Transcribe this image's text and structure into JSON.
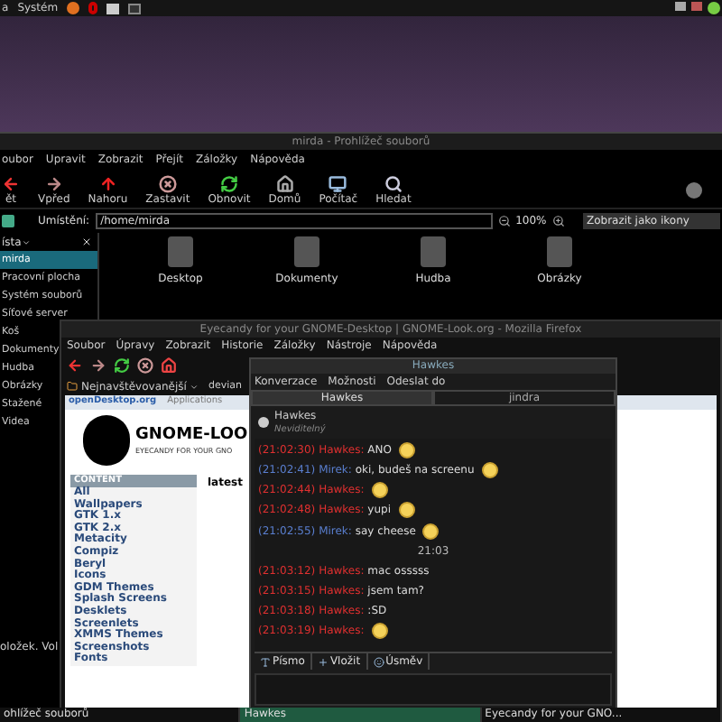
{
  "top_panel": {
    "menu": [
      "a",
      "Systém"
    ]
  },
  "file_browser": {
    "title": "mirda - Prohlížeč souborů",
    "menu": [
      "oubor",
      "Upravit",
      "Zobrazit",
      "Přejít",
      "Záložky",
      "Nápověda"
    ],
    "toolbar": [
      {
        "label": "ět",
        "kind": "back"
      },
      {
        "label": "Vpřed",
        "kind": "forward"
      },
      {
        "label": "Nahoru",
        "kind": "up"
      },
      {
        "label": "Zastavit",
        "kind": "stop"
      },
      {
        "label": "Obnovit",
        "kind": "reload"
      },
      {
        "label": "Domů",
        "kind": "home"
      },
      {
        "label": "Počítač",
        "kind": "computer"
      },
      {
        "label": "Hledat",
        "kind": "search"
      }
    ],
    "location_label": "Umístění:",
    "location": "/home/mirda",
    "zoom": "100%",
    "view_mode": "Zobrazit jako ikony",
    "sidebar_header": "ísta",
    "sidebar": [
      {
        "label": "mirda",
        "selected": true
      },
      {
        "label": "Pracovní plocha",
        "selected": false
      },
      {
        "label": "Systém souborů",
        "selected": false
      },
      {
        "label": "Síťové server",
        "selected": false
      },
      {
        "label": "Koš",
        "selected": false
      },
      {
        "label": "Dokumenty",
        "selected": false
      },
      {
        "label": "Hudba",
        "selected": false
      },
      {
        "label": "Obrázky",
        "selected": false
      },
      {
        "label": "Stažené",
        "selected": false
      },
      {
        "label": "Videa",
        "selected": false
      }
    ],
    "folders": [
      "Desktop",
      "Dokumenty",
      "Hudba",
      "Obrázky"
    ],
    "status": "oložek. Vol"
  },
  "browser": {
    "title": "Eyecandy for your GNOME-Desktop | GNOME-Look.org - Mozilla Firefox",
    "menu": [
      "Soubor",
      "Úpravy",
      "Zobrazit",
      "Historie",
      "Záložky",
      "Nástroje",
      "Nápověda"
    ],
    "bookmarks": [
      "Nejnavštěvovanější",
      "devian"
    ],
    "site_link": "openDesktop.org",
    "site_nav": [
      "Applications"
    ],
    "logo_text": "GNOME-LOO",
    "logo_tagline": "EYECANDY FOR YOUR GNO",
    "content_header": "CONTENT",
    "latest": "latest",
    "categories": [
      "All",
      "Wallpapers",
      "GTK 1.x",
      "GTK 2.x",
      "Metacity",
      "Compiz",
      "Beryl",
      "Icons",
      "GDM Themes",
      "Splash Screens",
      "Desklets",
      "Screenlets",
      "XMMS Themes",
      "Screenshots",
      "Fonts"
    ]
  },
  "chat": {
    "title": "Hawkes",
    "menu": [
      "Konverzace",
      "Možnosti",
      "Odeslat do"
    ],
    "tabs": [
      {
        "label": "Hawkes",
        "selected": true
      },
      {
        "label": "jindra",
        "selected": false
      }
    ],
    "contact": {
      "name": "Hawkes",
      "status": "Neviditelný"
    },
    "messages": [
      {
        "kind": "remote",
        "time": "(21:02:30)",
        "sender": "Hawkes:",
        "text": "ANO",
        "emoticon": true
      },
      {
        "kind": "local",
        "time": "(21:02:41)",
        "sender": "Mirek:",
        "text": "oki, budeš na screenu",
        "emoticon": true
      },
      {
        "kind": "remote",
        "time": "(21:02:44)",
        "sender": "Hawkes:",
        "emoticon": true
      },
      {
        "kind": "remote",
        "time": "(21:02:48)",
        "sender": "Hawkes:",
        "text": "yupi",
        "emoticon": true
      },
      {
        "kind": "local",
        "time": "(21:02:55)",
        "sender": "Mirek:",
        "text": "say cheese",
        "emoticon": true
      },
      {
        "kind": "separator",
        "text": "21:03"
      },
      {
        "kind": "remote",
        "time": "(21:03:12)",
        "sender": "Hawkes:",
        "text": "mac osssss",
        "emoticon": false
      },
      {
        "kind": "remote",
        "time": "(21:03:15)",
        "sender": "Hawkes:",
        "text": "jsem tam?",
        "emoticon": false
      },
      {
        "kind": "remote",
        "time": "(21:03:18)",
        "sender": "Hawkes:",
        "text": ":SD",
        "emoticon": false
      },
      {
        "kind": "remote",
        "time": "(21:03:19)",
        "sender": "Hawkes:",
        "emoticon": true
      }
    ],
    "buttons": [
      {
        "label": "Písmo",
        "kind": "font"
      },
      {
        "label": "Vložit",
        "kind": "insert"
      },
      {
        "label": "Úsměv",
        "kind": "smile"
      }
    ]
  },
  "taskbar": [
    "ohlížeč souborů",
    "Hawkes",
    "Eyecandy for your GNO..."
  ]
}
